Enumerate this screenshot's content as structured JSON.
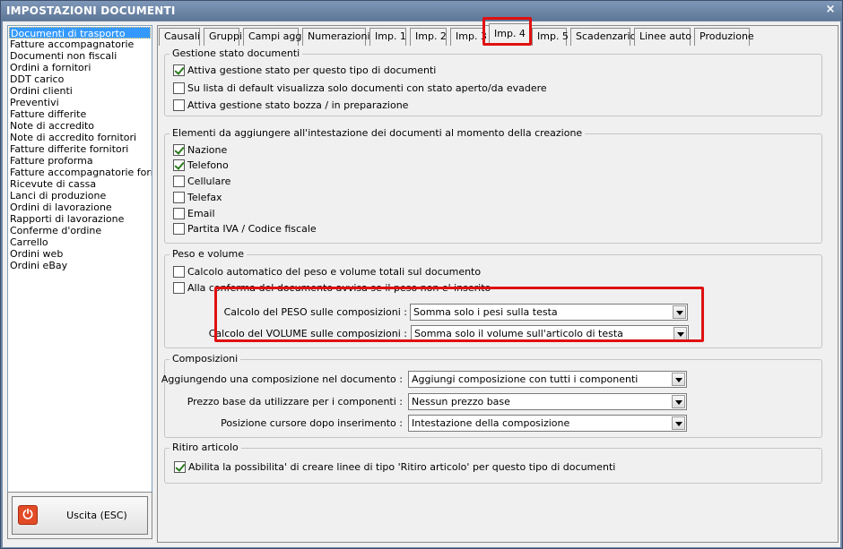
{
  "window": {
    "title": "IMPOSTAZIONI DOCUMENTI",
    "close_glyph": "×"
  },
  "doc_types": [
    "Documenti di trasporto",
    "Fatture accompagnatorie",
    "Documenti non fiscali",
    "Ordini a fornitori",
    "DDT carico",
    "Ordini clienti",
    "Preventivi",
    "Fatture differite",
    "Note di accredito",
    "Note di accredito fornitori",
    "Fatture differite fornitori",
    "Fatture proforma",
    "Fatture accompagnatorie fornitori",
    "Ricevute di cassa",
    "Lanci di produzione",
    "Ordini di lavorazione",
    "Rapporti di lavorazione",
    "Conferme d'ordine",
    "Carrello",
    "Ordini web",
    "Ordini eBay"
  ],
  "selected_doc_type": "Documenti di trasporto",
  "exit": {
    "label": "Uscita (ESC)",
    "icon": "power-icon"
  },
  "tabs": [
    "Causali",
    "Gruppi",
    "Campi agg.",
    "Numerazioni",
    "Imp. 1",
    "Imp. 2",
    "Imp. 3",
    "Imp. 4",
    "Imp. 5",
    "Scadenzario",
    "Linee auto",
    "Produzione"
  ],
  "active_tab": "Imp. 4",
  "stato": {
    "title": "Gestione stato documenti",
    "options": [
      {
        "label": "Attiva gestione stato per questo tipo di documenti",
        "checked": true
      },
      {
        "label": "Su lista di default visualizza solo documenti con stato aperto/da evadere",
        "checked": false
      },
      {
        "label": "Attiva gestione stato bozza / in preparazione",
        "checked": false
      }
    ]
  },
  "intestazione": {
    "title": "Elementi da aggiungere all'intestazione dei documenti al momento della creazione",
    "options": [
      {
        "label": "Nazione",
        "checked": true
      },
      {
        "label": "Telefono",
        "checked": true
      },
      {
        "label": "Cellulare",
        "checked": false
      },
      {
        "label": "Telefax",
        "checked": false
      },
      {
        "label": "Email",
        "checked": false
      },
      {
        "label": "Partita IVA / Codice fiscale",
        "checked": false
      }
    ]
  },
  "peso": {
    "title": "Peso e volume",
    "options": [
      {
        "label": "Calcolo automatico del peso e volume totali sul documento",
        "checked": false
      },
      {
        "label": "Alla conferma del documento avvisa se il peso non e' inserito",
        "checked": false
      }
    ],
    "peso_label": "Calcolo del PESO sulle composizioni :",
    "peso_value": "Somma solo i pesi sulla testa",
    "volume_label": "Calcolo del VOLUME sulle composizioni :",
    "volume_value": "Somma solo il volume sull'articolo di testa"
  },
  "composizioni": {
    "title": "Composizioni",
    "rows": [
      {
        "label": "Aggiungendo una composizione nel documento :",
        "value": "Aggiungi composizione con tutti i componenti"
      },
      {
        "label": "Prezzo base da utilizzare per i componenti :",
        "value": "Nessun prezzo base"
      },
      {
        "label": "Posizione cursore dopo inserimento :",
        "value": "Intestazione della composizione"
      }
    ]
  },
  "ritiro": {
    "title": "Ritiro articolo",
    "option": {
      "label": "Abilita la possibilita' di creare linee di tipo 'Ritiro articolo' per questo tipo di documenti",
      "checked": true
    }
  },
  "colors": {
    "selection": "#3399ff",
    "highlight": "#e01010",
    "check": "#2a7a1c",
    "title_bar": "#6f86a6"
  }
}
